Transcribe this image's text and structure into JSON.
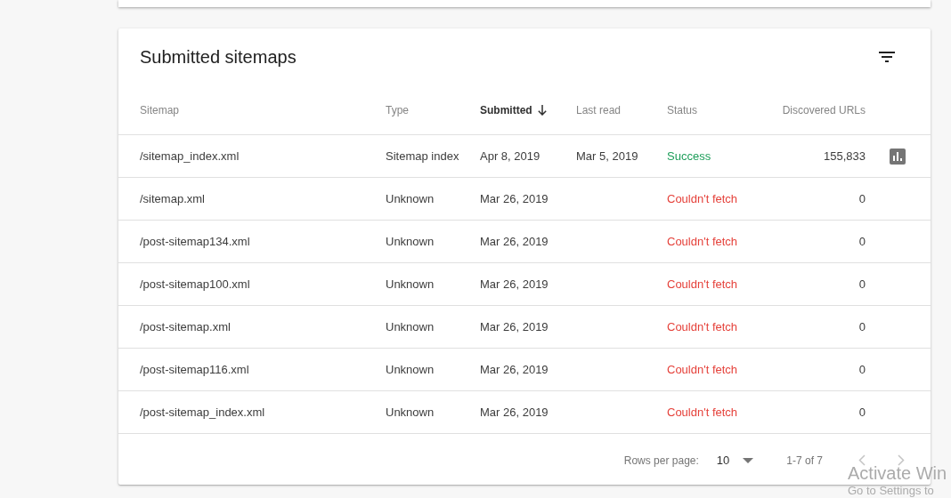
{
  "sitemaps_card": {
    "title": "Submitted sitemaps",
    "columns": [
      {
        "label": "Sitemap",
        "sorted": false
      },
      {
        "label": "Type",
        "sorted": false
      },
      {
        "label": "Submitted",
        "sorted": true
      },
      {
        "label": "Last read",
        "sorted": false
      },
      {
        "label": "Status",
        "sorted": false
      },
      {
        "label": "Discovered URLs",
        "sorted": false
      }
    ],
    "rows": [
      {
        "sitemap": "/sitemap_index.xml",
        "type": "Sitemap index",
        "submitted": "Apr 8, 2019",
        "last_read": "Mar 5, 2019",
        "status": {
          "label": "Success",
          "kind": "success"
        },
        "discovered_urls": "155,833",
        "report": true
      },
      {
        "sitemap": "/sitemap.xml",
        "type": "Unknown",
        "submitted": "Mar 26, 2019",
        "status": {
          "label": "Couldn't fetch",
          "kind": "error"
        },
        "discovered_urls": "0"
      },
      {
        "sitemap": "/post-sitemap134.xml",
        "type": "Unknown",
        "submitted": "Mar 26, 2019",
        "status": {
          "label": "Couldn't fetch",
          "kind": "error"
        },
        "discovered_urls": "0"
      },
      {
        "sitemap": "/post-sitemap100.xml",
        "type": "Unknown",
        "submitted": "Mar 26, 2019",
        "status": {
          "label": "Couldn't fetch",
          "kind": "error"
        },
        "discovered_urls": "0"
      },
      {
        "sitemap": "/post-sitemap.xml",
        "type": "Unknown",
        "submitted": "Mar 26, 2019",
        "status": {
          "label": "Couldn't fetch",
          "kind": "error"
        },
        "discovered_urls": "0"
      },
      {
        "sitemap": "/post-sitemap116.xml",
        "type": "Unknown",
        "submitted": "Mar 26, 2019",
        "status": {
          "label": "Couldn't fetch",
          "kind": "error"
        },
        "discovered_urls": "0"
      },
      {
        "sitemap": "/post-sitemap_index.xml",
        "type": "Unknown",
        "submitted": "Mar 26, 2019",
        "status": {
          "label": "Couldn't fetch",
          "kind": "error"
        },
        "discovered_urls": "0"
      }
    ],
    "pagination": {
      "rows_per_page_label": "Rows per page:",
      "rows_per_page": "10",
      "range": "1-7 of 7",
      "previous": {
        "disabled": true
      },
      "next": {
        "disabled": true
      }
    }
  },
  "activation_notice": {
    "title": "Activate Win",
    "hint": "Go to Settings to"
  }
}
